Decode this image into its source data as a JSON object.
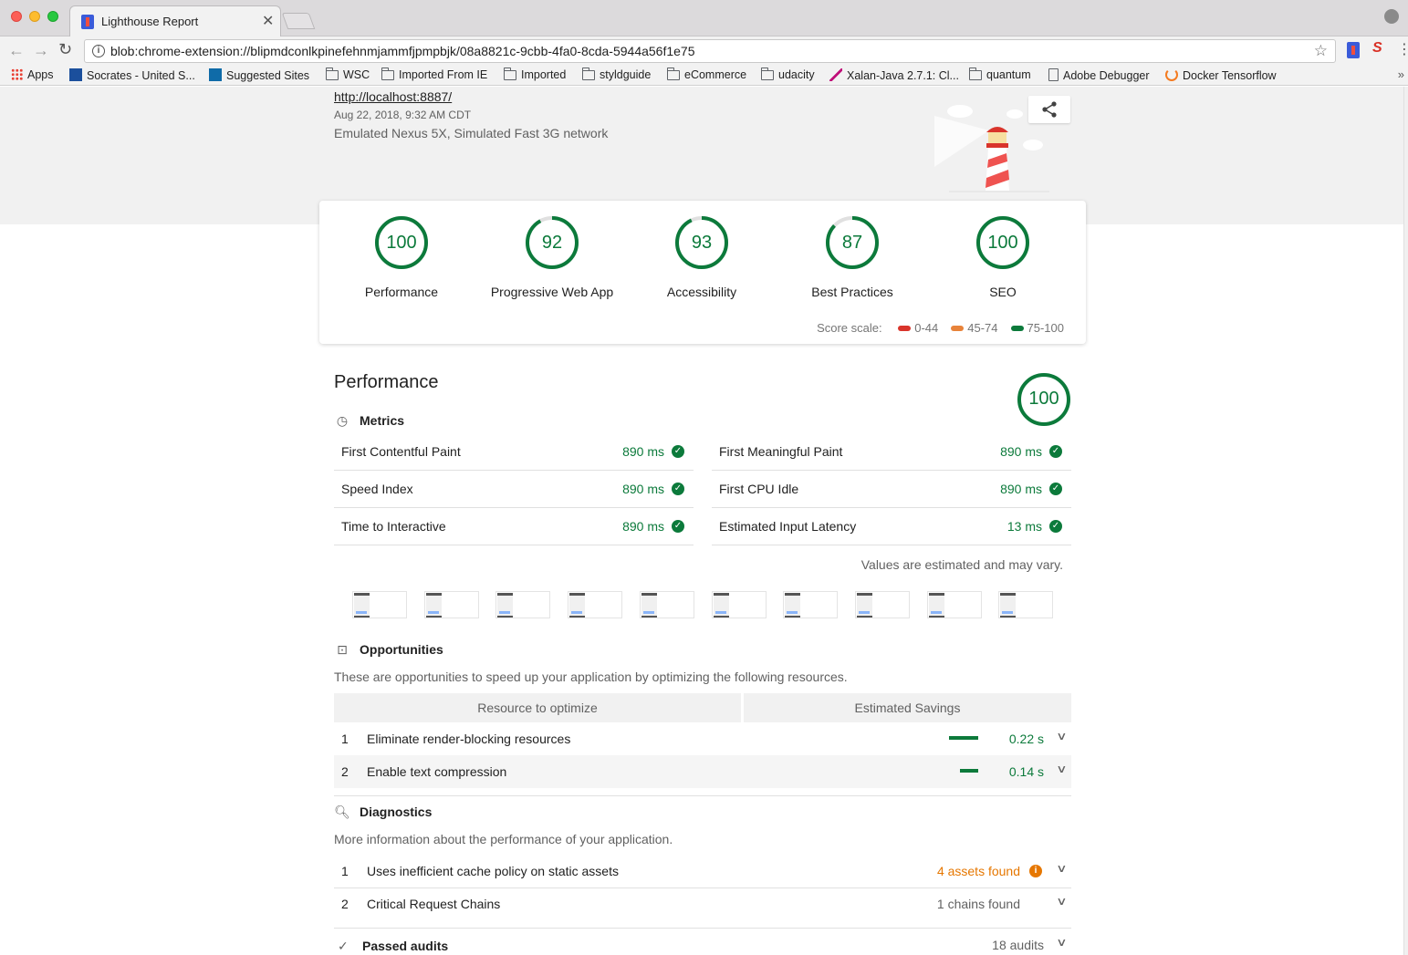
{
  "browser": {
    "tab_title": "Lighthouse Report",
    "url": "blob:chrome-extension://blipmdconlkpinefehnmjammfjpmpbjk/08a8821c-9cbb-4fa0-8cda-5944a56f1e75",
    "bookmarks": [
      {
        "label": "Apps",
        "icon": "apps-grid-icon"
      },
      {
        "label": "Socrates - United S...",
        "icon": "socrates-icon"
      },
      {
        "label": "Suggested Sites",
        "icon": "bing-icon"
      },
      {
        "label": "WSC",
        "icon": "folder-icon"
      },
      {
        "label": "Imported From IE",
        "icon": "folder-icon"
      },
      {
        "label": "Imported",
        "icon": "folder-icon"
      },
      {
        "label": "styldguide",
        "icon": "folder-icon"
      },
      {
        "label": "eCommerce",
        "icon": "folder-icon"
      },
      {
        "label": "udacity",
        "icon": "folder-icon"
      },
      {
        "label": "Xalan-Java 2.7.1: Cl...",
        "icon": "xalan-feather-icon"
      },
      {
        "label": "quantum",
        "icon": "folder-icon"
      },
      {
        "label": "Adobe Debugger",
        "icon": "page-icon"
      },
      {
        "label": "Docker Tensorflow",
        "icon": "docker-icon"
      }
    ]
  },
  "report": {
    "url": "http://localhost:8887/",
    "date": "Aug 22, 2018, 9:32 AM CDT",
    "environment": "Emulated Nexus 5X, Simulated Fast 3G network"
  },
  "categories": [
    {
      "label": "Performance",
      "score": 100
    },
    {
      "label": "Progressive Web App",
      "score": 92
    },
    {
      "label": "Accessibility",
      "score": 93
    },
    {
      "label": "Best Practices",
      "score": 87
    },
    {
      "label": "SEO",
      "score": 100
    }
  ],
  "score_scale": {
    "label": "Score scale:",
    "ranges": [
      {
        "label": "0-44",
        "color": "#d9342b"
      },
      {
        "label": "45-74",
        "color": "#e8833a"
      },
      {
        "label": "75-100",
        "color": "#0c7a3b"
      }
    ]
  },
  "colors": {
    "pass": "#0c7a3b",
    "average": "#e67700"
  },
  "performance": {
    "title": "Performance",
    "score": 100,
    "metrics_label": "Metrics",
    "metrics": [
      {
        "name": "First Contentful Paint",
        "value": "890 ms"
      },
      {
        "name": "First Meaningful Paint",
        "value": "890 ms"
      },
      {
        "name": "Speed Index",
        "value": "890 ms"
      },
      {
        "name": "First CPU Idle",
        "value": "890 ms"
      },
      {
        "name": "Time to Interactive",
        "value": "890 ms"
      },
      {
        "name": "Estimated Input Latency",
        "value": "13 ms"
      }
    ],
    "note": "Values are estimated and may vary.",
    "filmstrip_frames": 10,
    "opportunities": {
      "title": "Opportunities",
      "description": "These are opportunities to speed up your application by optimizing the following resources.",
      "col_resource": "Resource to optimize",
      "col_savings": "Estimated Savings",
      "items": [
        {
          "index": "1",
          "title": "Eliminate render-blocking resources",
          "savings": "0.22 s",
          "savings_seconds": 0.22
        },
        {
          "index": "2",
          "title": "Enable text compression",
          "savings": "0.14 s",
          "savings_seconds": 0.14
        }
      ]
    },
    "diagnostics": {
      "title": "Diagnostics",
      "description": "More information about the performance of your application.",
      "items": [
        {
          "index": "1",
          "title": "Uses inefficient cache policy on static assets",
          "value": "4 assets found"
        },
        {
          "index": "2",
          "title": "Critical Request Chains",
          "value": "1 chains found"
        }
      ]
    },
    "passed": {
      "title": "Passed audits",
      "count": "18 audits"
    }
  }
}
